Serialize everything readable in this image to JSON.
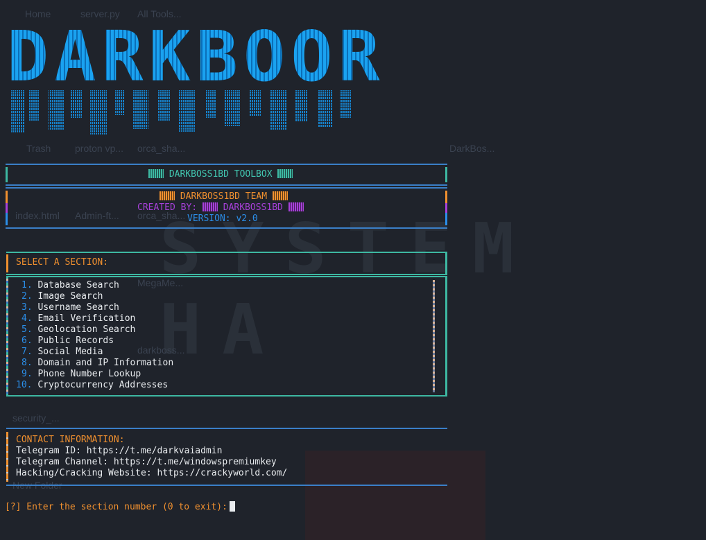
{
  "banner": {
    "text": "DARKBOOR"
  },
  "desktop_icons": [
    "Home",
    "server.py",
    "All Tools...",
    "Trash",
    "proton vp...",
    "orca_sha...",
    "DarkBos...",
    "index.html",
    "Admin-ft...",
    "orca_sha...",
    "MegaMe...",
    "darkboss...",
    "security_...",
    "New Folder"
  ],
  "toolbox": {
    "title": "DARKBOSS1BD TOOLBOX"
  },
  "team": {
    "name": "DARKBOSS1BD TEAM",
    "created_label": "CREATED BY:",
    "created_value": "DARKBOSS1BD",
    "version": "VERSION: v2.0"
  },
  "section": {
    "heading": "SELECT A SECTION:"
  },
  "menu": [
    {
      "num": "1.",
      "label": "Database Search"
    },
    {
      "num": "2.",
      "label": "Image Search"
    },
    {
      "num": "3.",
      "label": "Username Search"
    },
    {
      "num": "4.",
      "label": "Email Verification"
    },
    {
      "num": "5.",
      "label": "Geolocation Search"
    },
    {
      "num": "6.",
      "label": "Public Records"
    },
    {
      "num": "7.",
      "label": "Social Media"
    },
    {
      "num": "8.",
      "label": "Domain and IP Information"
    },
    {
      "num": "9.",
      "label": "Phone Number Lookup"
    },
    {
      "num": "10.",
      "label": "Cryptocurrency Addresses"
    }
  ],
  "contact": {
    "heading": "CONTACT INFORMATION:",
    "lines": [
      "Telegram ID: https://t.me/darkvaiadmin",
      "Telegram Channel: https://t.me/windowspremiumkey",
      "Hacking/Cracking Website: https://crackyworld.com/"
    ]
  },
  "prompt": {
    "text": "[?] Enter the section number (0 to exit):"
  },
  "colors": {
    "background": "#1f232b",
    "banner": "#1aa2f0",
    "teal": "#42c6b0",
    "orange": "#f0902f",
    "purple": "#a640d8",
    "blue": "#2b8ee8",
    "text": "#e9ecef"
  }
}
